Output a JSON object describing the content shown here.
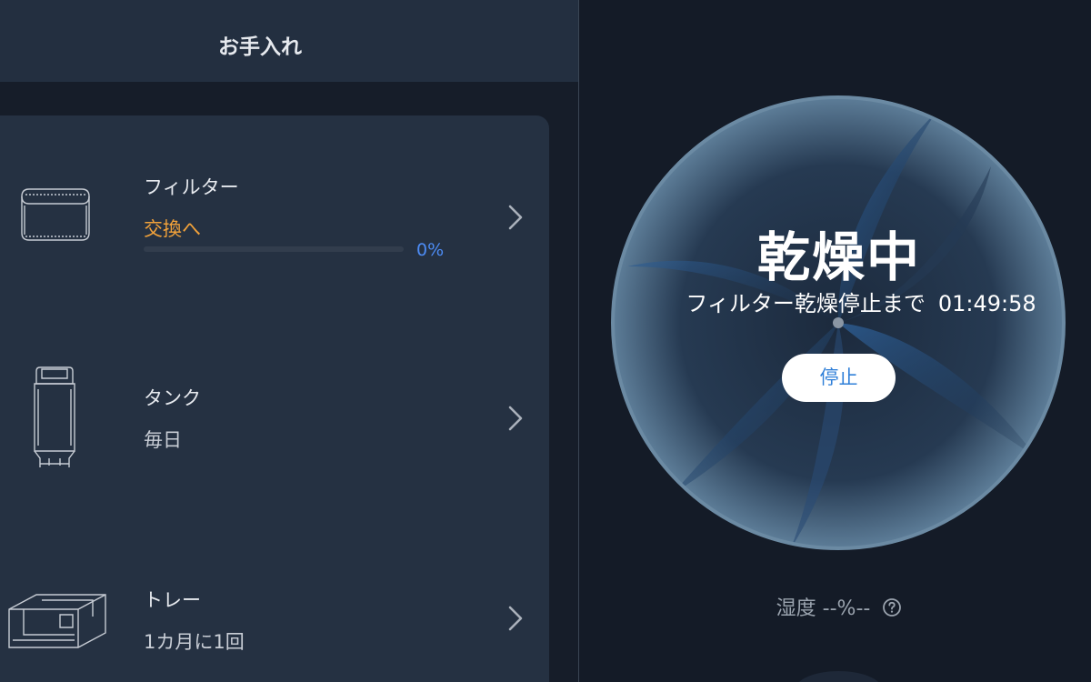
{
  "left_panel": {
    "title": "お手入れ",
    "items": [
      {
        "icon": "filter-icon",
        "title": "フィルター",
        "status": "交換へ",
        "status_color": "#f2a23a",
        "progress_percent": 0,
        "progress_label": "0%",
        "progress_color": "#4d8cf5"
      },
      {
        "icon": "tank-icon",
        "title": "タンク",
        "status": "毎日"
      },
      {
        "icon": "tray-icon",
        "title": "トレー",
        "status": "1カ月に1回"
      }
    ]
  },
  "right_panel": {
    "state_title": "乾燥中",
    "sub_text": "フィルター乾燥停止まで",
    "time_remaining": "01:49:58",
    "stop_button": "停止",
    "humidity_label": "湿度",
    "humidity_value": "--%--",
    "accent_color": "#2f7fd8"
  }
}
